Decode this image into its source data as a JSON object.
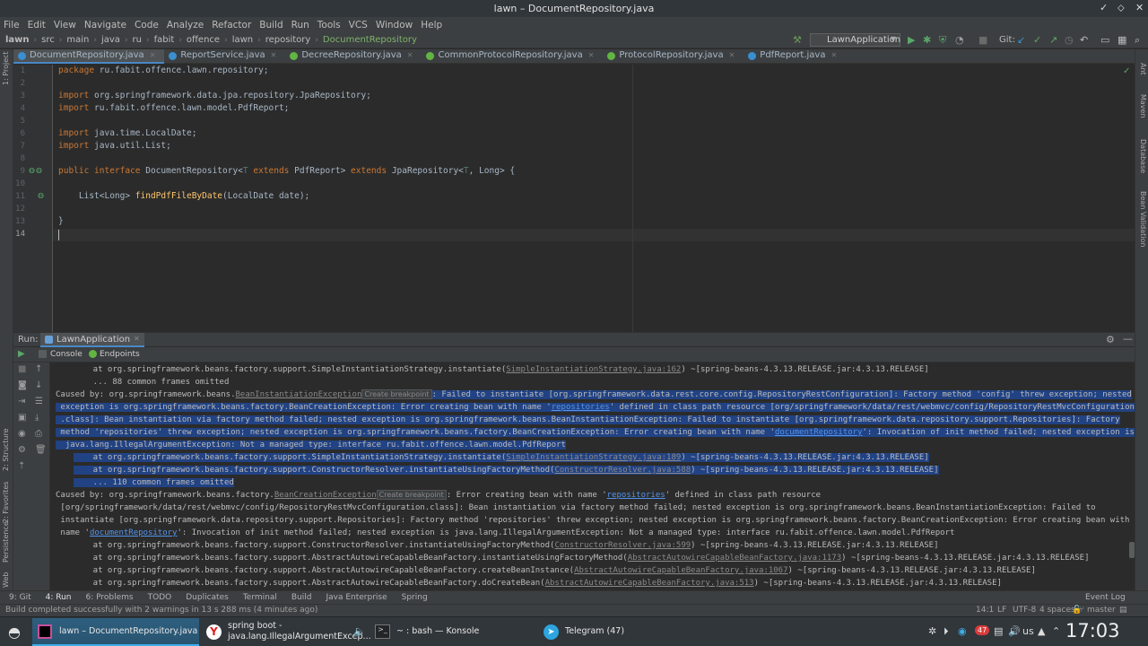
{
  "window": {
    "title": "lawn – DocumentRepository.java",
    "controls": [
      "✓",
      "⬦",
      "✕"
    ]
  },
  "menu": [
    "File",
    "Edit",
    "View",
    "Navigate",
    "Code",
    "Analyze",
    "Refactor",
    "Build",
    "Run",
    "Tools",
    "VCS",
    "Window",
    "Help"
  ],
  "breadcrumb": [
    "lawn",
    "src",
    "main",
    "java",
    "ru",
    "fabit",
    "offence",
    "lawn",
    "repository",
    "DocumentRepository"
  ],
  "toolbar": {
    "run_config": "LawnApplication",
    "git_label": "Git:"
  },
  "tabs": [
    {
      "label": "DocumentRepository.java",
      "active": true
    },
    {
      "label": "ReportService.java",
      "active": false
    },
    {
      "label": "DecreeRepository.java",
      "active": false
    },
    {
      "label": "CommonProtocolRepository.java",
      "active": false
    },
    {
      "label": "ProtocolRepository.java",
      "active": false
    },
    {
      "label": "PdfReport.java",
      "active": false
    }
  ],
  "left_stripe": [
    "1: Project",
    "2: Structure",
    "2: Favorites",
    "Persistence",
    "Web"
  ],
  "right_stripe": [
    "Ant",
    "Maven",
    "Database",
    "Bean Validation"
  ],
  "editor": {
    "line_numbers": [
      "1",
      "2",
      "3",
      "4",
      "5",
      "6",
      "7",
      "8",
      "9",
      "10",
      "11",
      "12",
      "13",
      "14"
    ],
    "lines": {
      "l1_kw": "package",
      "l1_rest": " ru.fabit.offence.lawn.repository;",
      "l3_kw": "import",
      "l3_rest": " org.springframework.data.jpa.repository.JpaRepository;",
      "l4_kw": "import",
      "l4_rest": " ru.fabit.offence.lawn.model.PdfReport;",
      "l6_kw": "import",
      "l6_rest": " java.time.LocalDate;",
      "l7_kw": "import",
      "l7_rest": " java.util.List;",
      "l9_kw1": "public interface",
      "l9_a": " DocumentRepository<",
      "l9_t1": "T",
      "l9_kw2": " extends",
      "l9_b": " PdfReport> ",
      "l9_kw3": "extends",
      "l9_c": " JpaRepository<",
      "l9_t2": "T",
      "l9_d": ", Long> {",
      "l11_a": "    List<Long> ",
      "l11_fn": "findPdfFileByDate",
      "l11_b": "(LocalDate date);",
      "l13": "}"
    }
  },
  "run_panel": {
    "label": "Run:",
    "config": "LawnApplication",
    "tabs": [
      "Console",
      "Endpoints"
    ]
  },
  "console": {
    "create_breakpoint": "Create breakpoint",
    "l1_a": "    at org.springframework.beans.factory.support.SimpleInstantiationStrategy.instantiate(",
    "l1_link": "SimpleInstantiationStrategy.java:162",
    "l1_b": ") ~[spring-beans-4.3.13.RELEASE.jar:4.3.13.RELEASE]",
    "l2": "    ... 88 common frames omitted",
    "l3_a": "Caused by: org.springframework.beans.",
    "l3_link": "BeanInstantiationException",
    "l3_b": ": Failed to instantiate [org.springframework.data.rest.core.config.RepositoryRestConfiguration]: Factory method 'config' threw exception; nested",
    "l4_a": " exception is org.springframework.beans.factory.BeanCreationException: Error creating bean with name '",
    "l4_link": "repositories",
    "l4_b": "' defined in class path resource [org/springframework/data/rest/webmvc/config/RepositoryRestMvcConfiguration",
    "l5": " .class]: Bean instantiation via factory method failed; nested exception is org.springframework.beans.BeanInstantiationException: Failed to instantiate [org.springframework.data.repository.support.Repositories]: Factory",
    "l6_a": " method 'repositories' threw exception; nested exception is org.springframework.beans.factory.BeanCreationException: Error creating bean with name '",
    "l6_link": "documentRepository",
    "l6_b": "': Invocation of init method failed; nested exception is",
    "l7": "  java.lang.IllegalArgumentException: Not a managed type: interface ru.fabit.offence.lawn.model.PdfReport",
    "l8_a": "    at org.springframework.beans.factory.support.SimpleInstantiationStrategy.instantiate(",
    "l8_link": "SimpleInstantiationStrategy.java:189",
    "l8_b": ") ~[spring-beans-4.3.13.RELEASE.jar:4.3.13.RELEASE]",
    "l9_a": "    at org.springframework.beans.factory.support.ConstructorResolver.instantiateUsingFactoryMethod(",
    "l9_link": "ConstructorResolver.java:588",
    "l9_b": ") ~[spring-beans-4.3.13.RELEASE.jar:4.3.13.RELEASE]",
    "l10": "    ... 110 common frames omitted",
    "l11_a": "Caused by: org.springframework.beans.factory.",
    "l11_link": "BeanCreationException",
    "l11_b": ": Error creating bean with name '",
    "l11_link2": "repositories",
    "l11_c": "' defined in class path resource",
    "l12": " [org/springframework/data/rest/webmvc/config/RepositoryRestMvcConfiguration.class]: Bean instantiation via factory method failed; nested exception is org.springframework.beans.BeanInstantiationException: Failed to",
    "l13": " instantiate [org.springframework.data.repository.support.Repositories]: Factory method 'repositories' threw exception; nested exception is org.springframework.beans.factory.BeanCreationException: Error creating bean with",
    "l14_a": " name '",
    "l14_link": "documentRepository",
    "l14_b": "': Invocation of init method failed; nested exception is java.lang.IllegalArgumentException: Not a managed type: interface ru.fabit.offence.lawn.model.PdfReport",
    "l15_a": "    at org.springframework.beans.factory.support.ConstructorResolver.instantiateUsingFactoryMethod(",
    "l15_link": "ConstructorResolver.java:599",
    "l15_b": ") ~[spring-beans-4.3.13.RELEASE.jar:4.3.13.RELEASE]",
    "l16_a": "    at org.springframework.beans.factory.support.AbstractAutowireCapableBeanFactory.instantiateUsingFactoryMethod(",
    "l16_link": "AbstractAutowireCapableBeanFactory.java:1173",
    "l16_b": ") ~[spring-beans-4.3.13.RELEASE.jar:4.3.13.RELEASE]",
    "l17_a": "    at org.springframework.beans.factory.support.AbstractAutowireCapableBeanFactory.createBeanInstance(",
    "l17_link": "AbstractAutowireCapableBeanFactory.java:1067",
    "l17_b": ") ~[spring-beans-4.3.13.RELEASE.jar:4.3.13.RELEASE]",
    "l18_a": "    at org.springframework.beans.factory.support.AbstractAutowireCapableBeanFactory.doCreateBean(",
    "l18_link": "AbstractAutowireCapableBeanFactory.java:513",
    "l18_b": ") ~[spring-beans-4.3.13.RELEASE.jar:4.3.13.RELEASE]"
  },
  "tool_windows": [
    "9: Git",
    "4: Run",
    "6: Problems",
    "TODO",
    "Duplicates",
    "Terminal",
    "Build",
    "Java Enterprise",
    "Spring",
    "Event Log"
  ],
  "status": {
    "message": "Build completed successfully with 2 warnings in 13 s 288 ms (4 minutes ago)",
    "position": "14:1",
    "line_sep": "LF",
    "encoding": "UTF-8",
    "indent": "4 spaces",
    "branch": "master"
  },
  "taskbar": {
    "tasks": [
      {
        "label": "lawn – DocumentRepository.java"
      },
      {
        "label_l1": "spring boot -",
        "label_l2": "java.lang.IllegalArgumentExcep..."
      },
      {
        "label": "~ : bash — Konsole"
      },
      {
        "label": "Telegram (47)"
      }
    ],
    "layout": "us",
    "clock": "17:03",
    "badge": "47"
  },
  "colors": {
    "accent": "#3daee9",
    "selection": "#214283",
    "keyword": "#cc7832",
    "function": "#ffc66d",
    "link": "#5394ec"
  }
}
